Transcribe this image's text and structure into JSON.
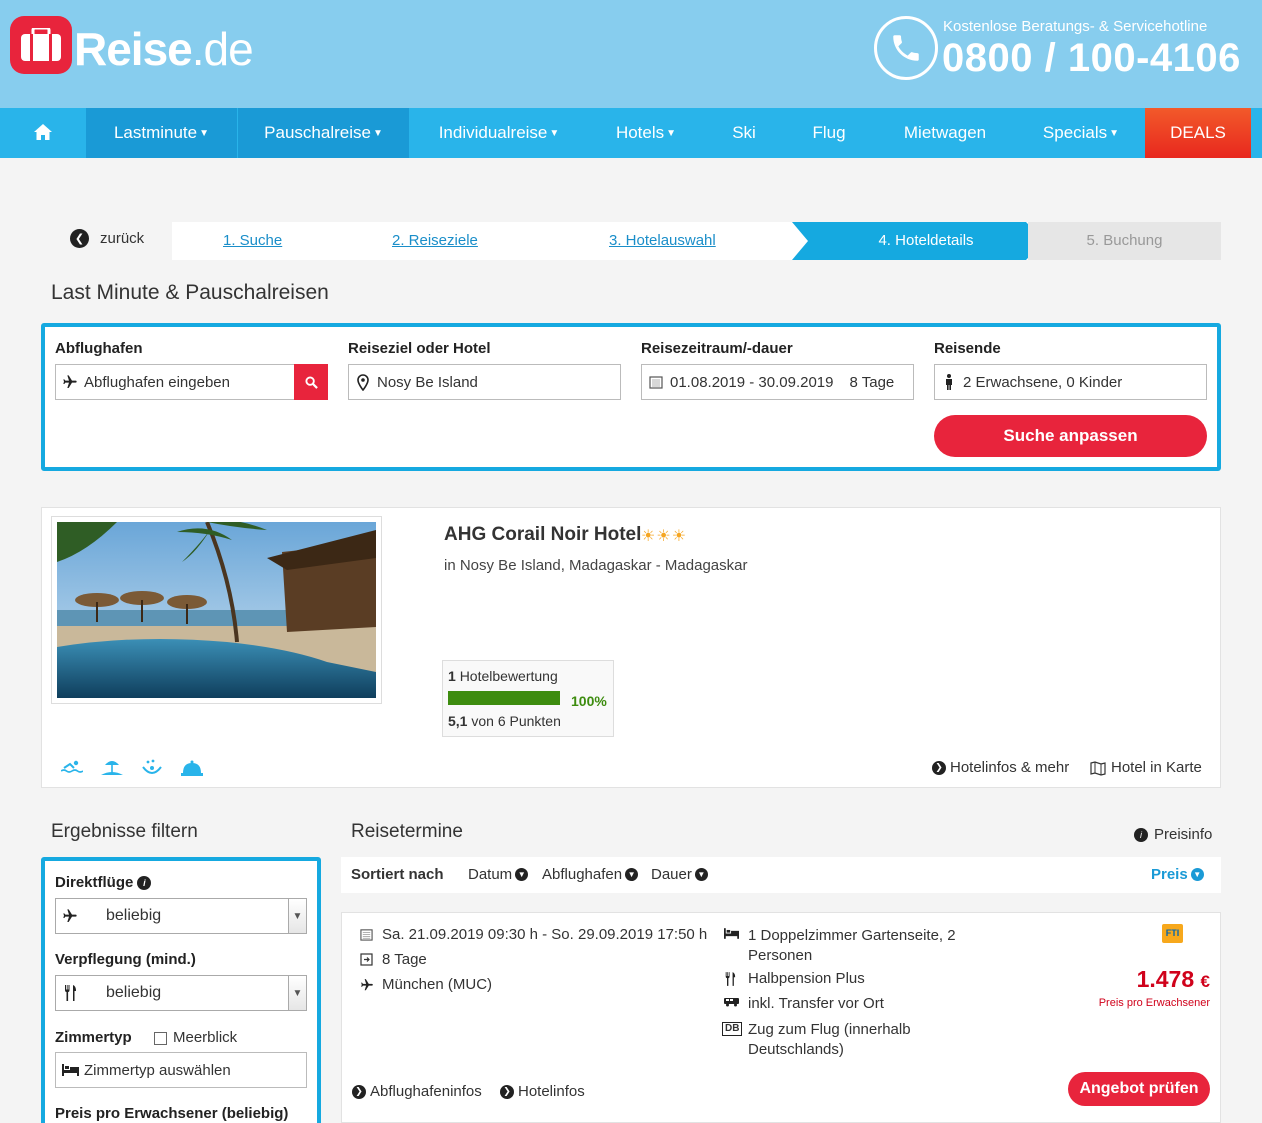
{
  "header": {
    "logo_main": "Reise",
    "logo_suffix": ".de",
    "hotline_label": "Kostenlose Beratungs- & Servicehotline",
    "hotline_number": "0800 / 100-4106"
  },
  "nav": {
    "items": [
      {
        "label": "Lastminute"
      },
      {
        "label": "Pauschalreise"
      },
      {
        "label": "Individualreise"
      },
      {
        "label": "Hotels"
      },
      {
        "label": "Ski"
      },
      {
        "label": "Flug"
      },
      {
        "label": "Mietwagen"
      },
      {
        "label": "Specials"
      },
      {
        "label": "DEALS"
      }
    ]
  },
  "steps": {
    "back": "zurück",
    "items": [
      "1. Suche",
      "2. Reiseziele",
      "3. Hotelauswahl",
      "4. Hoteldetails",
      "5. Buchung"
    ]
  },
  "search": {
    "title": "Last Minute & Pauschalreisen",
    "departure_label": "Abflughafen",
    "departure_placeholder": "Abflughafen eingeben",
    "destination_label": "Reiseziel oder Hotel",
    "destination_value": "Nosy Be Island",
    "period_label": "Reisezeitraum/-dauer",
    "period_value": "01.08.2019 - 30.09.2019",
    "duration_value": "8 Tage",
    "travelers_label": "Reisende",
    "travelers_value": "2 Erwachsene, 0 Kinder",
    "submit": "Suche anpassen"
  },
  "hotel": {
    "name": "AHG Corail Noir Hotel",
    "stars": "☀☀☀",
    "location": "in Nosy Be Island, Madagaskar - Madagaskar",
    "rating_count": "1",
    "rating_count_label": "Hotelbewertung",
    "rating_percent": "100%",
    "rating_fraction": 1.0,
    "rating_score": "5,1",
    "rating_score_suffix": "von 6 Punkten",
    "link_info": "Hotelinfos & mehr",
    "link_map": "Hotel in Karte"
  },
  "filter": {
    "title": "Ergebnisse filtern",
    "direct_label": "Direktflüge",
    "direct_value": "beliebig",
    "board_label": "Verpflegung (mind.)",
    "board_value": "beliebig",
    "room_label": "Zimmertyp",
    "seaview_label": "Meerblick",
    "room_placeholder": "Zimmertyp auswählen",
    "price_label": "Preis pro Erwachsener (beliebig)"
  },
  "results": {
    "title": "Reisetermine",
    "price_info": "Preisinfo",
    "sort_label": "Sortiert nach",
    "sort_date": "Datum",
    "sort_airport": "Abflughafen",
    "sort_duration": "Dauer",
    "sort_price": "Preis",
    "offer": {
      "dates": "Sa. 21.09.2019 09:30 h - So. 29.09.2019 17:50 h",
      "duration": "8 Tage",
      "airport": "München (MUC)",
      "room_line1": "1 Doppelzimmer Gartenseite, 2",
      "room_line2": "Personen",
      "board": "Halbpension Plus",
      "transfer": "inkl. Transfer vor Ort",
      "train_line1": "Zug zum Flug (innerhalb",
      "train_line2": "Deutschlands)",
      "train_badge": "DB",
      "operator_badge": "FTI",
      "price": "1.478",
      "currency": "€",
      "price_sub": "Preis pro Erwachsener",
      "link_airport": "Abflughafeninfos",
      "link_hotel": "Hotelinfos",
      "cta": "Angebot prüfen"
    }
  },
  "colors": {
    "header_bg": "#87cdee",
    "nav_bg": "#29b4ea",
    "accent_red": "#e8243c",
    "border_blue": "#15a9e0"
  }
}
